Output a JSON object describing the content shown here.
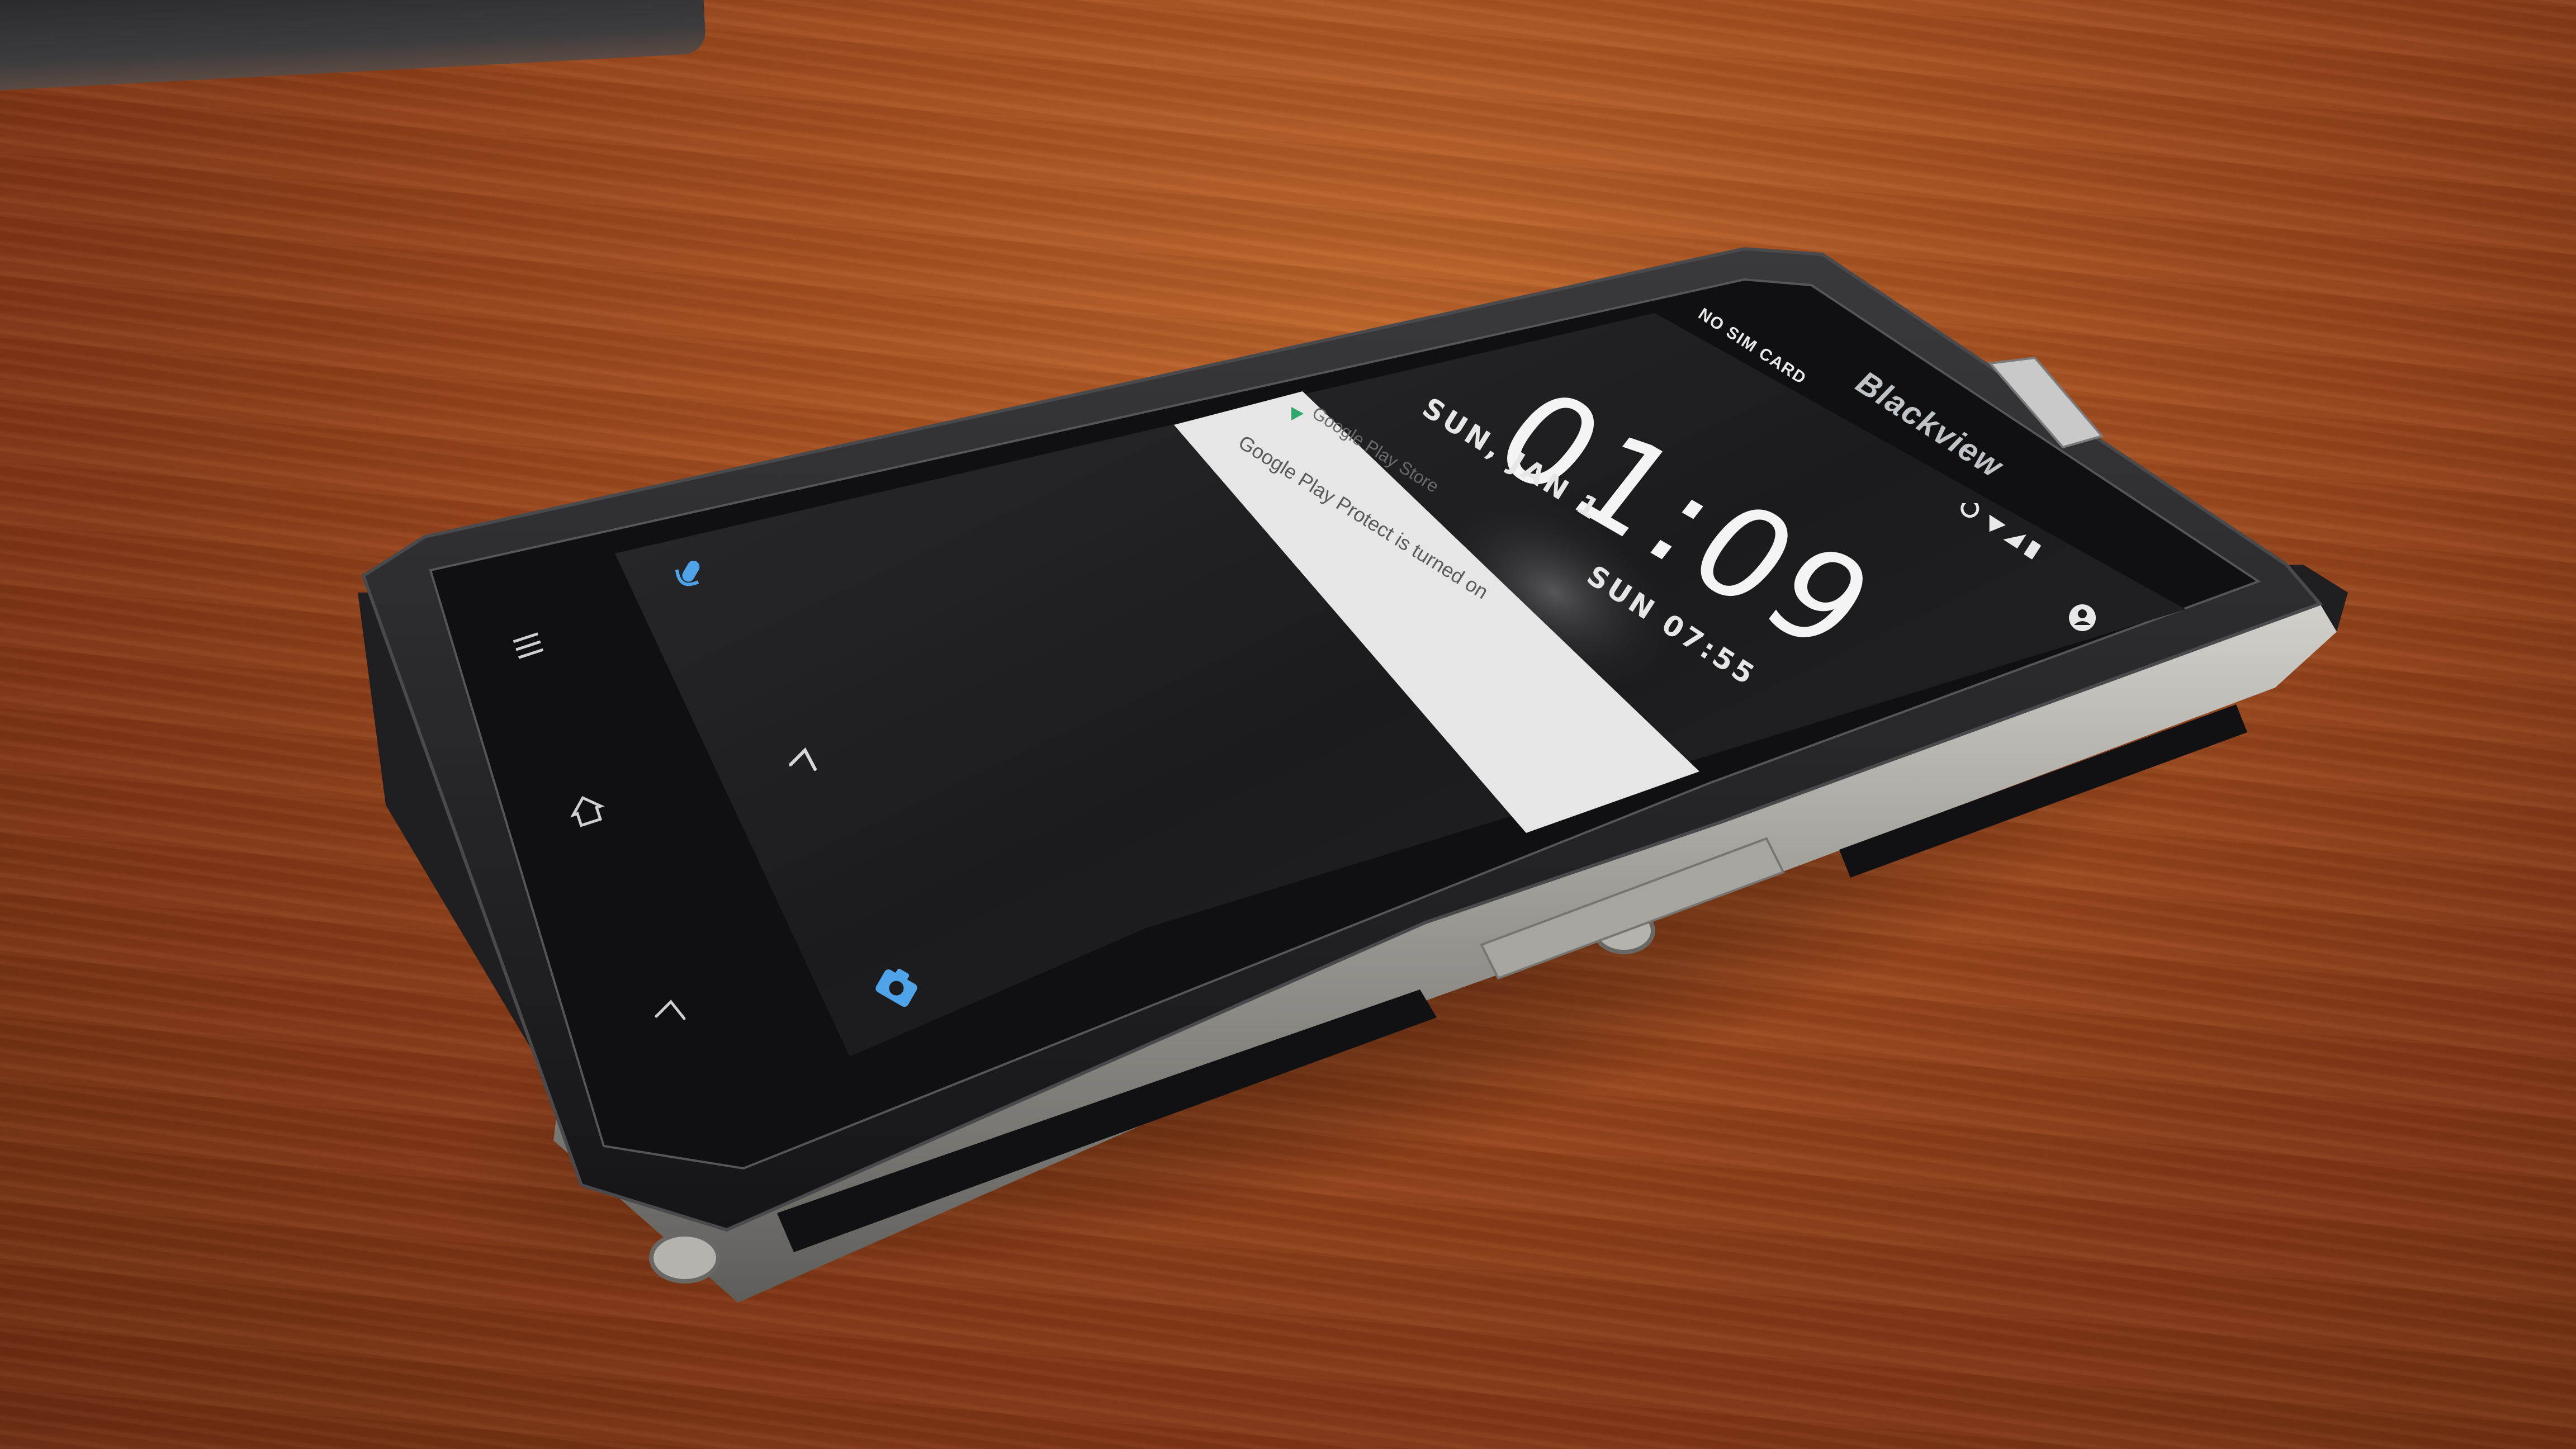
{
  "status_bar": {
    "carrier": "NO SIM CARD"
  },
  "brand": {
    "logo_text": "Blackview"
  },
  "lock_screen": {
    "time": "01:09",
    "date": "SUN, JAN 1",
    "alarm_time": "SUN 07:55"
  },
  "notification": {
    "title": "Google Play Store",
    "text": "Google Play Protect is turned on"
  },
  "icons": {
    "voice": "mic-icon",
    "camera": "camera-icon",
    "unlock": "chevron-up-icon",
    "menu": "menu-icon",
    "home": "home-icon",
    "back": "back-icon",
    "alarm": "alarm-icon",
    "wifi": "wifi-icon",
    "signal": "signal-icon",
    "battery": "battery-icon",
    "user": "user-icon"
  },
  "colors": {
    "table": "#a24d1f",
    "screen": "#1c1c1e",
    "notification_bg": "#e4e4e4",
    "accent_icon": "#4fa3e8",
    "metal_frame": "#8e8c88"
  }
}
